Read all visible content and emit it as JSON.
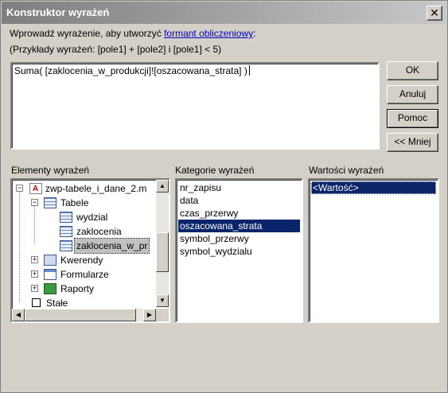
{
  "window": {
    "title": "Konstruktor wyrażeń",
    "close_label": "✕"
  },
  "prompt": {
    "line1_prefix": "Wprowadź wyrażenie, aby utworzyć ",
    "line1_link": "formant obliczeniowy",
    "line1_suffix": ":",
    "line2": "(Przykłady wyrażeń: [pole1] + [pole2] i [pole1] < 5)"
  },
  "expression": {
    "value": "Suma( [zaklocenia_w_produkcji]![oszacowana_strata] )"
  },
  "buttons": {
    "ok": "OK",
    "anuluj": "Anuluj",
    "pomoc": "Pomoc",
    "mniej": "<< Mniej"
  },
  "sections": {
    "elements_label": "Elementy wyrażeń",
    "categories_label": "Kategorie wyrażeń",
    "values_label": "Wartości wyrażeń"
  },
  "tree": {
    "items": [
      {
        "label": "zwp-tabele_i_dane_2.m",
        "icon": "database-icon",
        "expanded": true
      },
      {
        "label": "Tabele",
        "icon": "tables-icon",
        "expanded": true
      },
      {
        "label": "wydzial",
        "icon": "table-icon"
      },
      {
        "label": "zaklocenia",
        "icon": "table-icon"
      },
      {
        "label": "zaklocenia_w_pr",
        "icon": "table-icon",
        "selected": true
      },
      {
        "label": "Kwerendy",
        "icon": "query-icon",
        "expanded": false
      },
      {
        "label": "Formularze",
        "icon": "form-icon",
        "expanded": false
      },
      {
        "label": "Raporty",
        "icon": "report-icon",
        "expanded": false
      },
      {
        "label": "Stałe",
        "icon": "constant-icon"
      }
    ]
  },
  "categories": {
    "items": [
      "nr_zapisu",
      "data",
      "czas_przerwy",
      "oszacowana_strata",
      "symbol_przerwy",
      "symbol_wydzialu"
    ],
    "selected": "oszacowana_strata"
  },
  "values": {
    "items": [
      "<Wartość>"
    ],
    "selected": "<Wartość>"
  },
  "colors": {
    "dialog_bg": "#d4d0c8",
    "selection": "#0a246a",
    "link": "#0000cc"
  }
}
